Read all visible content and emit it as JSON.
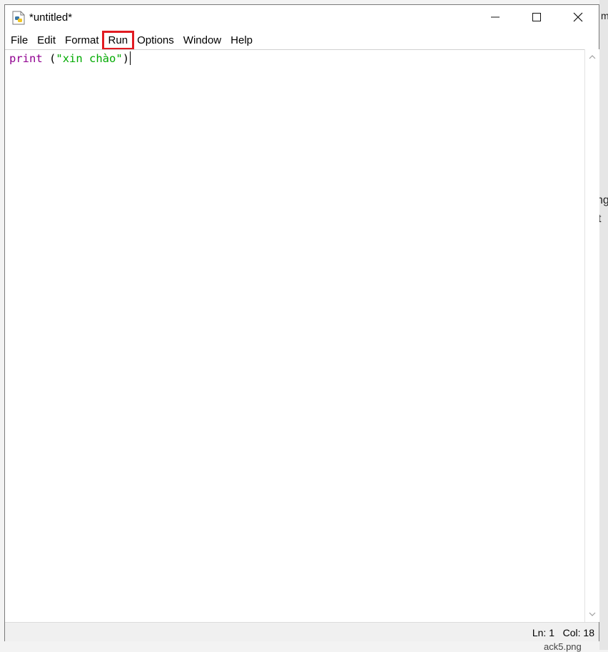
{
  "window": {
    "title": "*untitled*",
    "controls": {
      "minimize_icon": "minimize-icon",
      "maximize_icon": "maximize-icon",
      "close_icon": "close-icon"
    }
  },
  "menu": {
    "items": [
      {
        "label": "File"
      },
      {
        "label": "Edit"
      },
      {
        "label": "Format"
      },
      {
        "label": "Run",
        "highlighted": true
      },
      {
        "label": "Options"
      },
      {
        "label": "Window"
      },
      {
        "label": "Help"
      }
    ],
    "highlight_color": "#e11b22"
  },
  "editor": {
    "code": {
      "keyword": "print",
      "space": " ",
      "open_paren": "(",
      "string": "\"xin chào\"",
      "close_paren": ")"
    },
    "colors": {
      "keyword": "#900090",
      "string": "#00aa00"
    }
  },
  "status": {
    "line": "Ln: 1",
    "column": "Col: 18"
  },
  "background_fragments": {
    "right_1": "ng",
    "right_2": "t",
    "top_right": "m",
    "bottom_right": "ack5.png"
  }
}
